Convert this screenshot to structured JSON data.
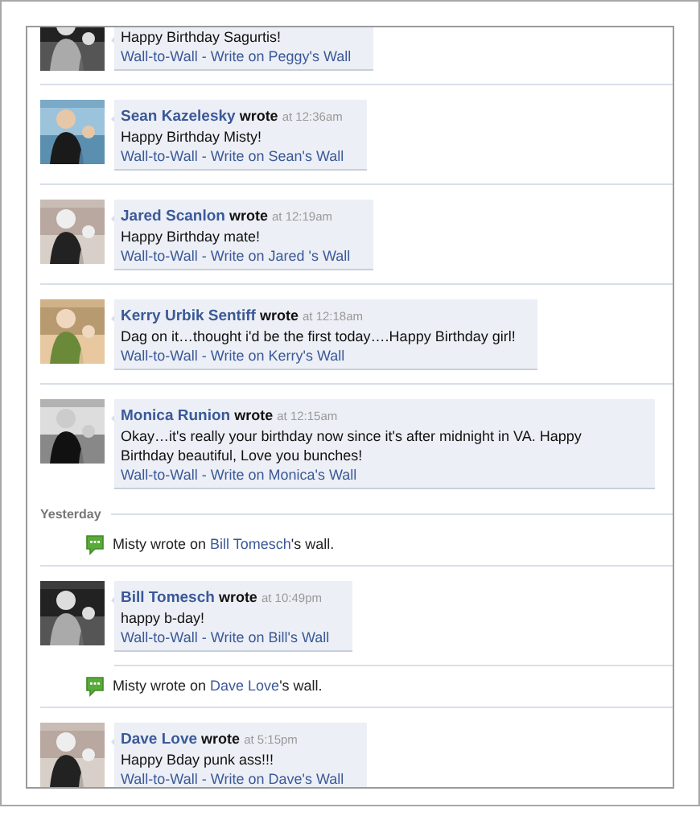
{
  "feed": {
    "items": [
      {
        "kind": "post",
        "message": "Happy Birthday Sagurtis!",
        "links": {
          "wall_to_wall": "Wall-to-Wall",
          "separator": "-",
          "write_on": "Write on Peggy's Wall"
        }
      },
      {
        "kind": "post",
        "author": "Sean Kazelesky",
        "verb": "wrote",
        "time": "at 12:36am",
        "message": "Happy Birthday Misty!",
        "links": {
          "wall_to_wall": "Wall-to-Wall",
          "separator": "-",
          "write_on": "Write on Sean's Wall"
        }
      },
      {
        "kind": "post",
        "author": "Jared Scanlon",
        "verb": "wrote",
        "time": "at 12:19am",
        "message": "Happy Birthday mate!",
        "links": {
          "wall_to_wall": "Wall-to-Wall",
          "separator": "-",
          "write_on": "Write on Jared 's Wall"
        }
      },
      {
        "kind": "post",
        "author": "Kerry Urbik Sentiff",
        "verb": "wrote",
        "time": "at 12:18am",
        "message": "Dag on it…thought i'd be the first today….Happy Birthday girl!",
        "links": {
          "wall_to_wall": "Wall-to-Wall",
          "separator": "-",
          "write_on": "Write on Kerry's Wall"
        }
      },
      {
        "kind": "post",
        "author": "Monica Runion",
        "verb": "wrote",
        "time": "at 12:15am",
        "message": "Okay…it's really your birthday now since it's after midnight in VA. Happy Birthday beautiful, Love you bunches!",
        "links": {
          "wall_to_wall": "Wall-to-Wall",
          "separator": "-",
          "write_on": "Write on Monica's Wall"
        }
      },
      {
        "kind": "day",
        "label": "Yesterday"
      },
      {
        "kind": "activity",
        "before": "Misty wrote on ",
        "link": "Bill Tomesch",
        "after": "'s wall."
      },
      {
        "kind": "post",
        "author": "Bill Tomesch",
        "verb": "wrote",
        "time": "at 10:49pm",
        "message": "happy b-day!",
        "links": {
          "wall_to_wall": "Wall-to-Wall",
          "separator": "-",
          "write_on": "Write on Bill's Wall"
        }
      },
      {
        "kind": "activity",
        "before": "Misty wrote on ",
        "link": "Dave Love",
        "after": "'s wall."
      },
      {
        "kind": "post",
        "author": "Dave Love",
        "verb": "wrote",
        "time": "at 5:15pm",
        "message": "Happy Bday punk ass!!!",
        "links": {
          "wall_to_wall": "Wall-to-Wall",
          "separator": "-",
          "write_on": "Write on Dave's Wall"
        }
      }
    ]
  }
}
